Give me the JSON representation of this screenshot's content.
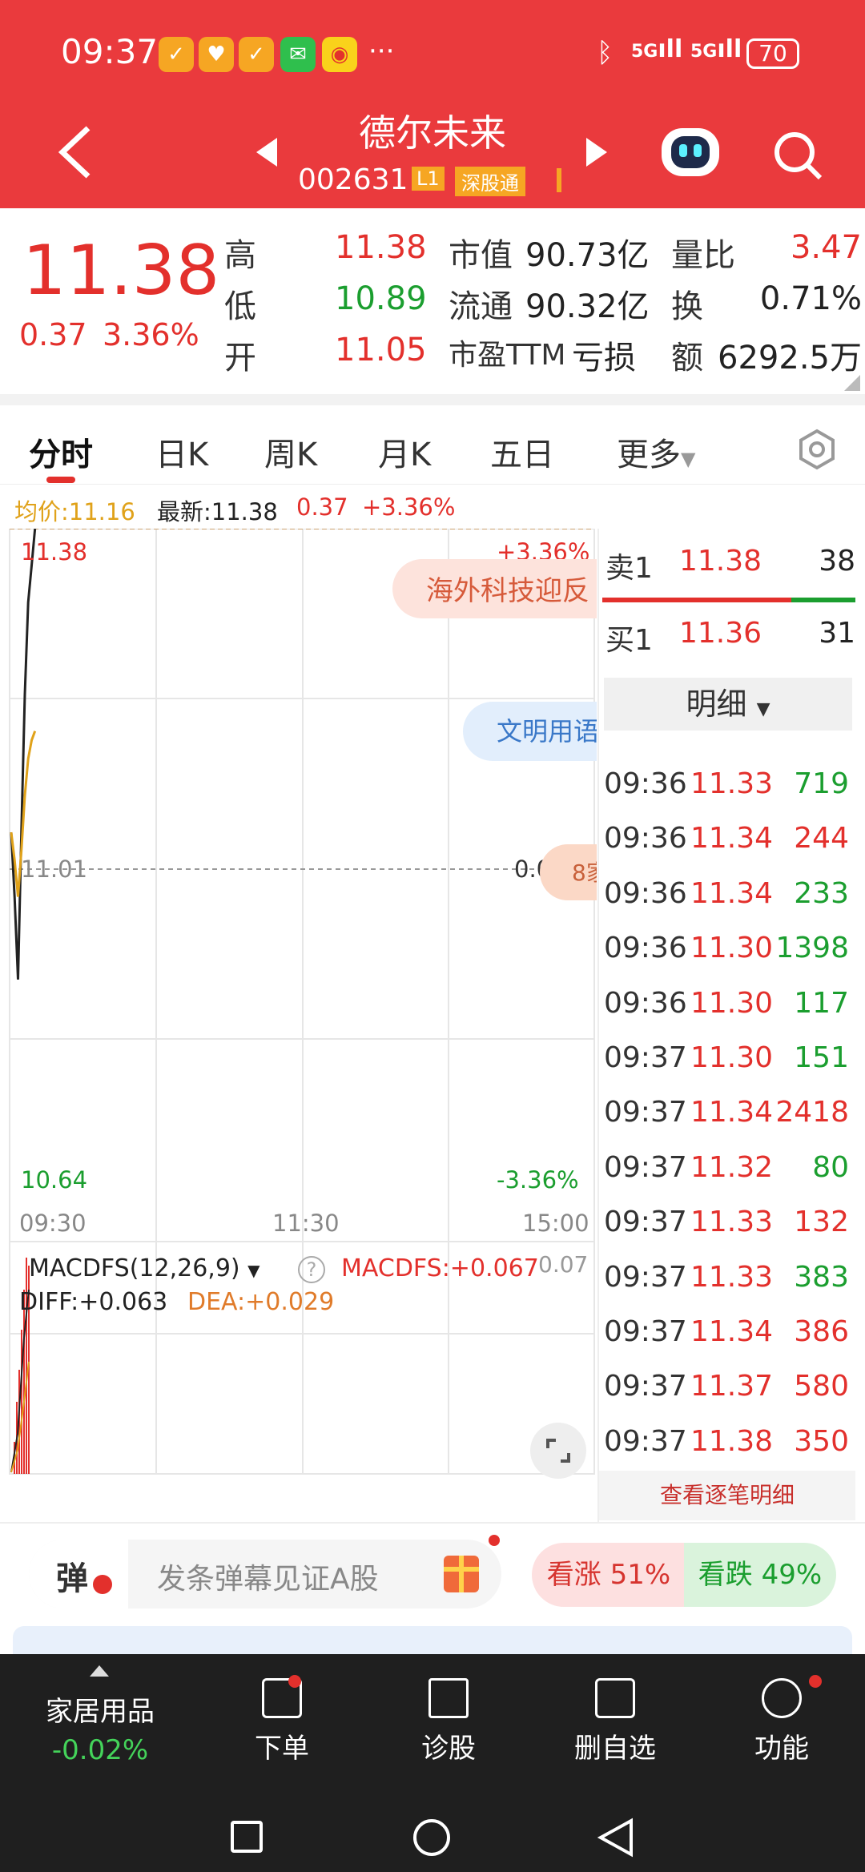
{
  "status_bar": {
    "time": "09:37",
    "more": "···",
    "net1": "5G",
    "net2": "5G",
    "battery": "70"
  },
  "header": {
    "title": "德尔未来",
    "code": "002631",
    "level_badge": "L1",
    "exchange_badge": "深股通"
  },
  "quote": {
    "price": "11.38",
    "change": "0.37",
    "change_pct": "3.36%",
    "high_label": "高",
    "high": "11.38",
    "low_label": "低",
    "low": "10.89",
    "open_label": "开",
    "open": "11.05",
    "mcap_label": "市值",
    "mcap": "90.73亿",
    "float_label": "流通",
    "float": "90.32亿",
    "pe_label": "市盈TTM",
    "pe": "亏损",
    "vol_ratio_label": "量比",
    "vol_ratio": "3.47",
    "turnover_label": "换",
    "turnover": "0.71%",
    "amount_label": "额",
    "amount": "6292.5万"
  },
  "tabs": [
    "分时",
    "日K",
    "周K",
    "月K",
    "五日",
    "更多"
  ],
  "info_line": {
    "avg_label": "均价:11.16",
    "latest_label": "最新:11.38",
    "chg": "0.37",
    "pct": "+3.36%"
  },
  "chart": {
    "y_top": "11.38",
    "y_mid": "11.01",
    "y_bot": "10.64",
    "pct_top": "+3.36%",
    "pct_mid": "0.00%",
    "pct_bot": "-3.36%",
    "x_labels": [
      "09:30",
      "11:30",
      "15:00"
    ],
    "news1": "海外科技迎反",
    "news2": "文明用语",
    "news3": "8家",
    "macd_label": "MACDFS(12,26,9)",
    "macd_value": "MACDFS:+0.067",
    "macd_scale": "0.07",
    "diff": "DIFF:+0.063",
    "dea": "DEA:+0.029"
  },
  "chart_data": {
    "type": "line",
    "x": [
      "09:30",
      "09:31",
      "09:32",
      "09:33",
      "09:34",
      "09:35",
      "09:36",
      "09:37"
    ],
    "series": [
      {
        "values": [
          11.05,
          10.98,
          10.89,
          11.05,
          11.2,
          11.3,
          11.34,
          11.38
        ]
      },
      {
        "values": [
          11.05,
          11.02,
          10.98,
          11.03,
          11.09,
          11.13,
          11.15,
          11.16
        ]
      }
    ],
    "ylim": [
      10.64,
      11.38
    ]
  },
  "order_book": {
    "sell_label": "卖1",
    "sell_price": "11.38",
    "sell_vol": "38",
    "buy_label": "买1",
    "buy_price": "11.36",
    "buy_vol": "31",
    "detail_label": "明细"
  },
  "trades": [
    {
      "t": "09:36",
      "p": "11.33",
      "v": "719",
      "pc": "red",
      "vc": "green"
    },
    {
      "t": "09:36",
      "p": "11.34",
      "v": "244",
      "pc": "red",
      "vc": "red"
    },
    {
      "t": "09:36",
      "p": "11.34",
      "v": "233",
      "pc": "red",
      "vc": "green"
    },
    {
      "t": "09:36",
      "p": "11.30",
      "v": "1398",
      "pc": "red",
      "vc": "green"
    },
    {
      "t": "09:36",
      "p": "11.30",
      "v": "117",
      "pc": "red",
      "vc": "green"
    },
    {
      "t": "09:37",
      "p": "11.30",
      "v": "151",
      "pc": "red",
      "vc": "green"
    },
    {
      "t": "09:37",
      "p": "11.34",
      "v": "2418",
      "pc": "red",
      "vc": "red"
    },
    {
      "t": "09:37",
      "p": "11.32",
      "v": "80",
      "pc": "red",
      "vc": "green"
    },
    {
      "t": "09:37",
      "p": "11.33",
      "v": "132",
      "pc": "red",
      "vc": "red"
    },
    {
      "t": "09:37",
      "p": "11.33",
      "v": "383",
      "pc": "red",
      "vc": "green"
    },
    {
      "t": "09:37",
      "p": "11.34",
      "v": "386",
      "pc": "red",
      "vc": "red"
    },
    {
      "t": "09:37",
      "p": "11.37",
      "v": "580",
      "pc": "red",
      "vc": "red"
    },
    {
      "t": "09:37",
      "p": "11.38",
      "v": "350",
      "pc": "red",
      "vc": "red"
    }
  ],
  "view_all": "查看逐笔明细",
  "danmu": {
    "badge": "弹",
    "placeholder": "发条弹幕见证A股",
    "up": "看涨 51%",
    "down": "看跌 49%"
  },
  "bottom_nav": {
    "sector": "家居用品",
    "sector_chg": "-0.02%",
    "items": [
      "下单",
      "诊股",
      "删自选",
      "功能"
    ]
  },
  "colors": {
    "brand": "#ea3a3d",
    "up": "#e3302c",
    "down": "#1b9e2f",
    "avg": "#e0a21a"
  }
}
